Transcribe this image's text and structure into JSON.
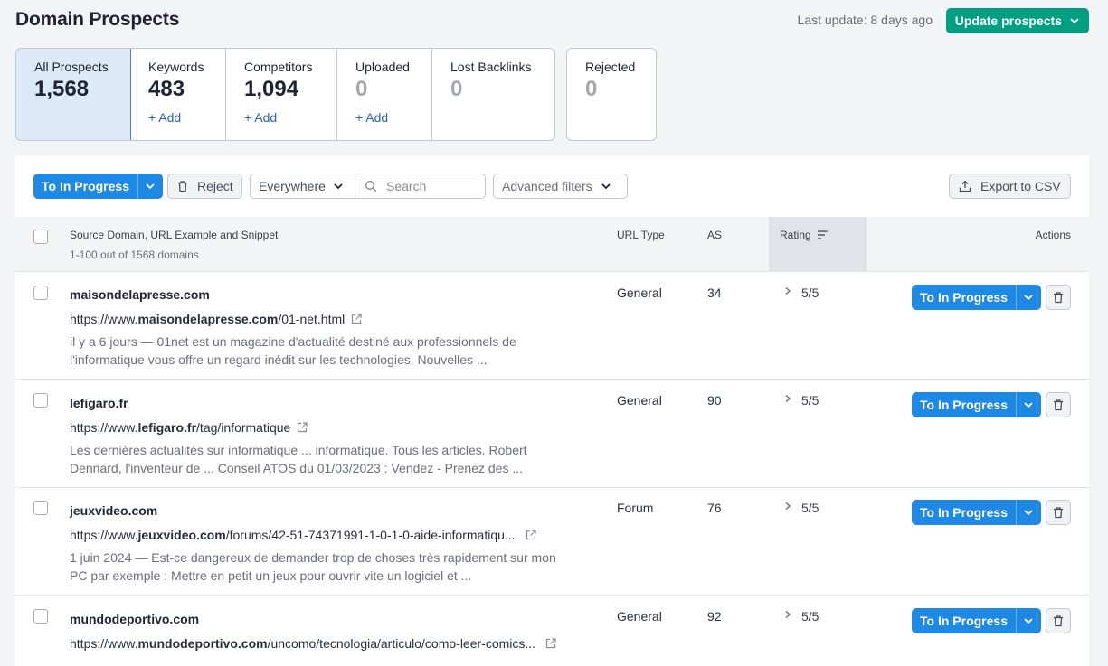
{
  "header": {
    "title": "Domain Prospects",
    "last_update": "Last update: 8 days ago",
    "update_button": "Update prospects"
  },
  "tabs": [
    {
      "label": "All Prospects",
      "count": "1,568",
      "add": ""
    },
    {
      "label": "Keywords",
      "count": "483",
      "add": "+ Add"
    },
    {
      "label": "Competitors",
      "count": "1,094",
      "add": "+ Add"
    },
    {
      "label": "Uploaded",
      "count": "0",
      "add": "+ Add"
    },
    {
      "label": "Lost Backlinks",
      "count": "0",
      "add": ""
    },
    {
      "label": "Rejected",
      "count": "0",
      "add": ""
    }
  ],
  "toolbar": {
    "to_in_progress": "To In Progress",
    "reject": "Reject",
    "scope": "Everywhere",
    "search_placeholder": "Search",
    "advanced_filters": "Advanced filters",
    "export": "Export to CSV"
  },
  "table": {
    "col_source": "Source Domain, URL Example and Snippet",
    "col_source_sub": "1-100 out of 1568 domains",
    "col_url_type": "URL Type",
    "col_as": "AS",
    "col_rating": "Rating",
    "col_actions": "Actions",
    "action_label": "To In Progress",
    "rows": [
      {
        "domain": "maisondelapresse.com",
        "url_prefix": "https://www.",
        "url_domain": "maisondelapresse.com",
        "url_path": "/01-net.html",
        "snippet1": "il y a 6 jours — 01net est un magazine d'actualité destiné aux professionnels de",
        "snippet2": "l'informatique vous offre un regard inédit sur les technologies. Nouvelles ...",
        "url_type": "General",
        "as": "34",
        "rating": "5/5"
      },
      {
        "domain": "lefigaro.fr",
        "url_prefix": "https://www.",
        "url_domain": "lefigaro.fr",
        "url_path": "/tag/informatique",
        "snippet1": "Les dernières actualités sur informatique ... informatique. Tous les articles. Robert",
        "snippet2": "Dennard, l'inventeur de ... Conseil ATOS du 01/03/2023 : Vendez - Prenez des ...",
        "url_type": "General",
        "as": "90",
        "rating": "5/5"
      },
      {
        "domain": "jeuxvideo.com",
        "url_prefix": "https://www.",
        "url_domain": "jeuxvideo.com",
        "url_path": "/forums/42-51-74371991-1-0-1-0-aide-informatiqu...",
        "snippet1": "1 juin 2024 — Est-ce dangereux de demander trop de choses très rapidement sur mon",
        "snippet2": "PC par exemple : Mettre en petit un jeux pour ouvrir vite un logiciel et ...",
        "url_type": "Forum",
        "as": "76",
        "rating": "5/5"
      },
      {
        "domain": "mundodeportivo.com",
        "url_prefix": "https://www.",
        "url_domain": "mundodeportivo.com",
        "url_path": "/uncomo/tecnologia/articulo/como-leer-comics...",
        "snippet1": "",
        "snippet2": "",
        "url_type": "General",
        "as": "92",
        "rating": "5/5"
      }
    ]
  },
  "colors": {
    "primary": "#1e88e5",
    "update_green": "#009f81",
    "active_tab": "#dce9f8"
  }
}
